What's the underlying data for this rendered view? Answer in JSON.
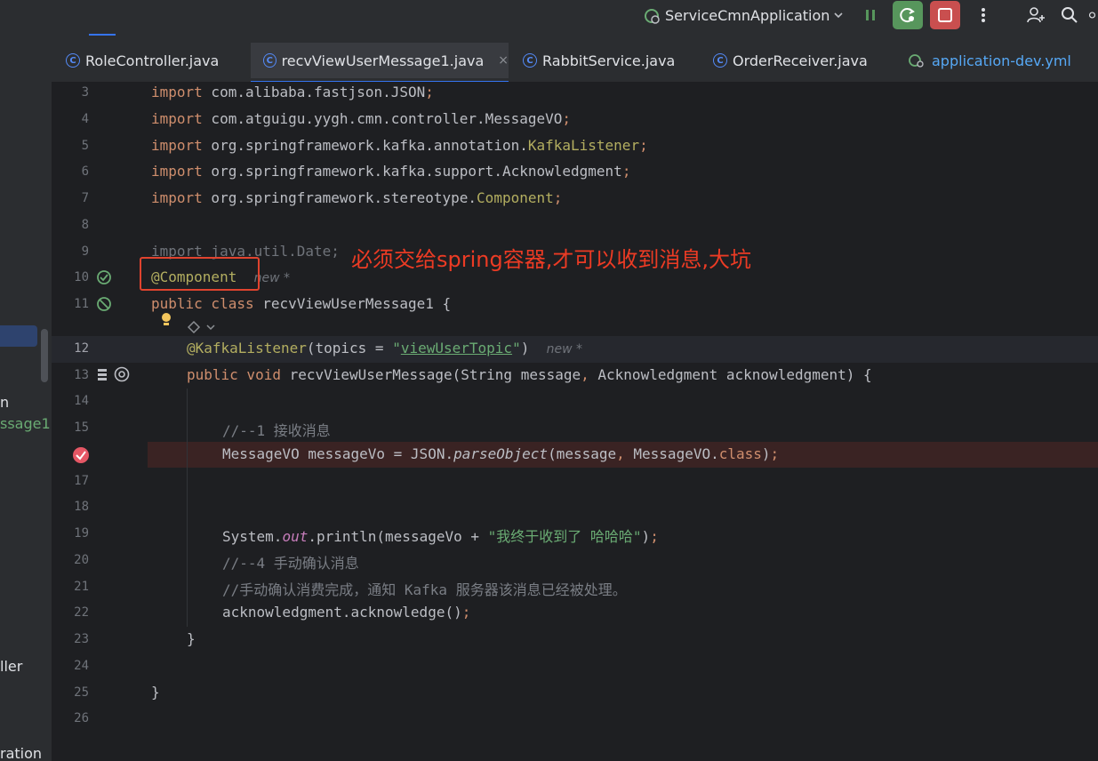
{
  "toolbar": {
    "run_config": "ServiceCmnApplication",
    "colors": {
      "rerun": "#57965c",
      "stop": "#c94f4f",
      "pause": "#57965c"
    }
  },
  "tabs": [
    {
      "label": "RoleController.java",
      "icon": "class-icon",
      "active": false
    },
    {
      "label": "recvViewUserMessage1.java",
      "icon": "class-icon",
      "active": true,
      "close": "×"
    },
    {
      "label": "RabbitService.java",
      "icon": "class-icon",
      "active": false
    },
    {
      "label": "OrderReceiver.java",
      "icon": "class-icon",
      "active": false
    },
    {
      "label": "application-dev.yml",
      "icon": "yaml-icon",
      "active": false
    }
  ],
  "left_panel": {
    "fragments": [
      "n",
      "ssage1",
      "ller",
      "ration"
    ]
  },
  "line_numbers": [
    "3",
    "4",
    "5",
    "6",
    "7",
    "8",
    "9",
    "10",
    "11",
    "12",
    "13",
    "14",
    "15",
    "16",
    "17",
    "18",
    "19",
    "20",
    "21",
    "22",
    "23",
    "24",
    "25",
    "26"
  ],
  "code": {
    "l3a": "import",
    "l3b": " com.alibaba.fastjson.JSON",
    "l3c": ";",
    "l4a": "import",
    "l4b": " com.atguigu.yygh.cmn.controller.MessageVO",
    "l4c": ";",
    "l5a": "import",
    "l5b": " org.springframework.kafka.annotation.",
    "l5c": "KafkaListener",
    "l5d": ";",
    "l6a": "import",
    "l6b": " org.springframework.kafka.support.Acknowledgment",
    "l6c": ";",
    "l7a": "import",
    "l7b": " org.springframework.stereotype.",
    "l7c": "Component",
    "l7d": ";",
    "l9": "import java.util.Date;",
    "l10a": "@Component",
    "l10hint": "new *",
    "l11a": "public class",
    "l11b": " recvViewUserMessage1 {",
    "l12a": "@KafkaListener",
    "l12b": "(topics = ",
    "l12c": "\"",
    "l12d": "viewUserTopic",
    "l12e": "\"",
    "l12f": ")",
    "l12hint": "new *",
    "l13a": "public void",
    "l13b": " recvViewUserMessage",
    "l13c": "(String message",
    "l13d": ",",
    "l13e": " Acknowledgment acknowledgment) {",
    "l15": "//--1 接收消息",
    "l16a": "MessageVO messageVo = JSON.",
    "l16b": "parseObject",
    "l16c": "(message",
    "l16d": ",",
    "l16e": " MessageVO.",
    "l16f": "class",
    "l16g": ")",
    "l16h": ";",
    "l19a": "System.",
    "l19b": "out",
    "l19c": ".println(messageVo + ",
    "l19d": "\"我终于收到了 哈哈哈\"",
    "l19e": ")",
    "l19f": ";",
    "l20": "//--4 手动确认消息",
    "l21": "//手动确认消费完成，通知 Kafka 服务器该消息已经被处理。",
    "l22a": "acknowledgment.acknowledge()",
    "l22b": ";",
    "l23": "}",
    "l25": "}"
  },
  "annotation": {
    "text": "必须交给spring容器,才可以收到消息,大坑",
    "color": "#ec3b24"
  }
}
